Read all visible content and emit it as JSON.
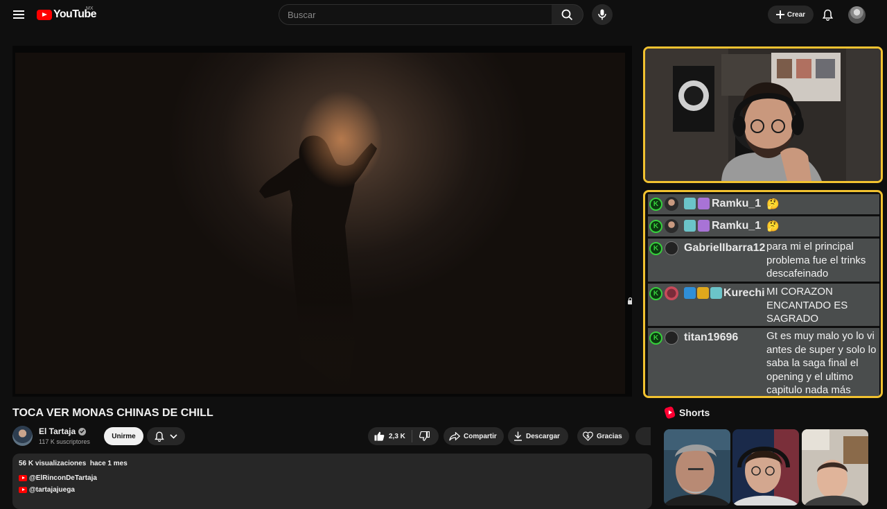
{
  "masthead": {
    "logo_text": "YouTube",
    "country_code": "MX",
    "search_placeholder": "Buscar",
    "create_label": "Crear"
  },
  "video": {
    "title": "TOCA VER MONAS CHINAS DE CHILL"
  },
  "channel": {
    "name": "El Tartaja",
    "subscribers": "117 K suscriptores",
    "join_label": "Unirme"
  },
  "actions": {
    "likes": "2,3 K",
    "share_label": "Compartir",
    "download_label": "Descargar",
    "thanks_label": "Gracias"
  },
  "description": {
    "views": "56 K visualizaciones",
    "date": "hace 1 mes",
    "links": [
      "@ElRinconDeTartaja",
      "@tartajajuega"
    ]
  },
  "chat": {
    "messages": [
      {
        "user": "Ramku_1",
        "text": "🤔"
      },
      {
        "user": "Ramku_1",
        "text": "🤔"
      },
      {
        "user": "GabrielIbarra12",
        "text": "para mi el principal problema fue el trinks descafeinado"
      },
      {
        "user": "Kurechi",
        "text": "MI CORAZON ENCANTADO ES SAGRADO"
      },
      {
        "user": "titan19696",
        "text": "Gt es muy malo yo lo vi antes de super y solo lo saba la saga final el opening y el ultimo capitulo nada más"
      }
    ]
  },
  "shorts": {
    "heading": "Shorts"
  },
  "colors": {
    "background": "#0f0f0f",
    "overlay_border": "#f2c230",
    "chat_row": "#4a4d4d",
    "brand_red": "#ff0000",
    "chat_k_badge": "#36d03c"
  }
}
